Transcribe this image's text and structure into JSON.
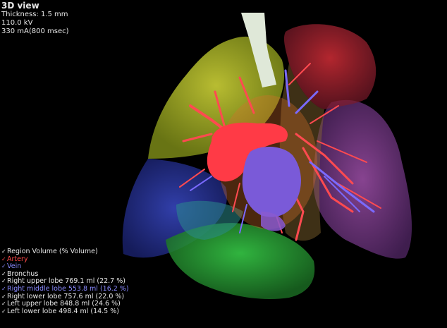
{
  "viewer": {
    "title": "3D view",
    "thickness": "Thickness: 1.5 mm",
    "kv": "110.0 kV",
    "ma": "330 mA(800 msec)"
  },
  "legend": {
    "header": "Region Volume (% Volume)",
    "items": [
      {
        "label": "Artery",
        "color": "#ff4a4a"
      },
      {
        "label": "Vein",
        "color": "#8a8aff"
      },
      {
        "label": "Bronchus",
        "color": "#f0f0f0"
      },
      {
        "label": "Right upper lobe 769.1 ml (22.7 %)",
        "color": "#e8e8e8"
      },
      {
        "label": "Right middle lobe 553.8 ml (16.2 %)",
        "color": "#8a8aff"
      },
      {
        "label": "Right lower lobe 757.6 ml (22.0 %)",
        "color": "#e8e8e8"
      },
      {
        "label": "Left upper lobe 848.8 ml (24.6 %)",
        "color": "#e8e8e8"
      },
      {
        "label": "Left lower lobe 498.4 ml (14.5 %)",
        "color": "#e8e8e8"
      }
    ],
    "check": "✓"
  },
  "colors": {
    "right_upper_lobe": "#c8d22a",
    "right_middle_lobe": "#2a3aa8",
    "right_lower_lobe": "#2aa83a",
    "left_upper_lobe": "#c81e2a",
    "left_lower_lobe": "#9a3aa8",
    "artery": "#ff3a46",
    "vein": "#6a4ad8",
    "bronchus": "#e8f0e0"
  }
}
